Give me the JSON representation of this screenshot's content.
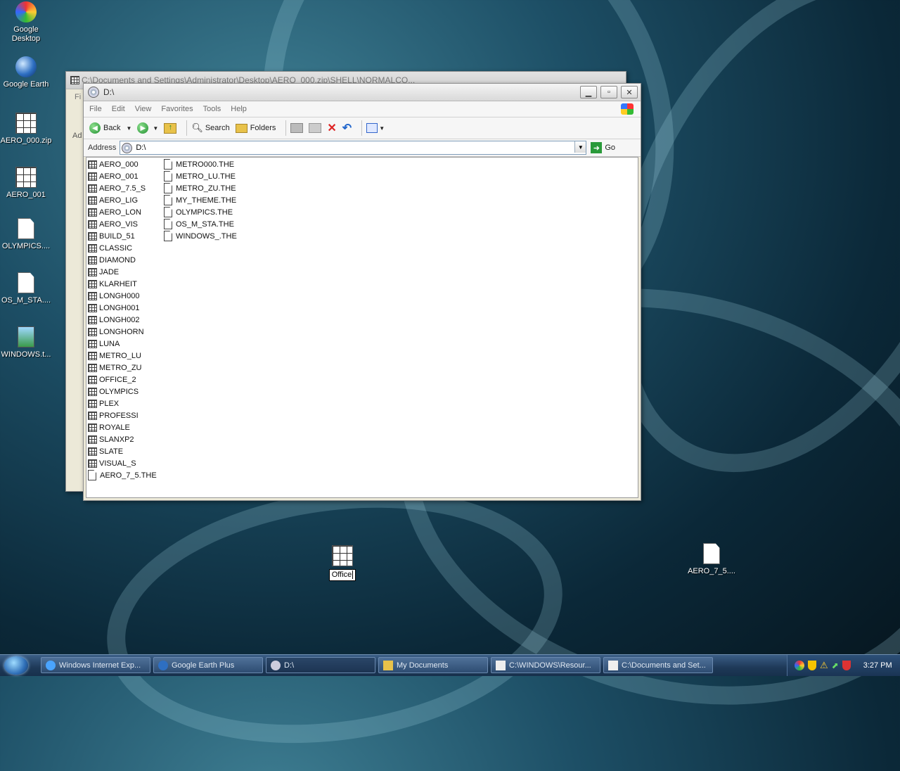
{
  "desktop": {
    "icons": [
      {
        "label_line1": "Google",
        "label_line2": "Desktop",
        "icon": "google-desktop-icon"
      },
      {
        "label": "Google Earth",
        "icon": "google-earth-icon"
      },
      {
        "label": "AERO_000.zip",
        "icon": "theme-file-icon"
      },
      {
        "label": "AERO_001",
        "icon": "theme-file-icon"
      },
      {
        "label": "OLYMPICS....",
        "icon": "document-icon"
      },
      {
        "label": "OS_M_STA....",
        "icon": "document-icon"
      },
      {
        "label": "WINDOWS.t...",
        "icon": "image-file-icon"
      }
    ],
    "renaming_icon_value": "Office",
    "aero_icon_label": "AERO_7_5...."
  },
  "back_window": {
    "title": "C:\\Documents and Settings\\Administrator\\Desktop\\AERO_000.zip\\SHELL\\NORMALCO...",
    "menu_fragment": "Fi",
    "address_fragment": "Ad"
  },
  "explorer": {
    "title": "D:\\",
    "menu": [
      "File",
      "Edit",
      "View",
      "Favorites",
      "Tools",
      "Help"
    ],
    "toolbar": {
      "back": "Back",
      "search": "Search",
      "folders": "Folders"
    },
    "address_label": "Address",
    "address_value": "D:\\",
    "go_label": "Go",
    "files_col1": [
      "AERO_000",
      "AERO_001",
      "AERO_7.5_S",
      "AERO_LIG",
      "AERO_LON",
      "AERO_VIS",
      "BUILD_51",
      "CLASSIC",
      "DIAMOND",
      "JADE",
      "KLARHEIT",
      "LONGH000",
      "LONGH001",
      "LONGH002",
      "LONGHORN",
      "LUNA",
      "METRO_LU",
      "METRO_ZU",
      "OFFICE_2",
      "OLYMPICS",
      "PLEX",
      "PROFESSI",
      "ROYALE",
      "SLANXP2",
      "SLATE",
      "VISUAL_S"
    ],
    "files_col1_doc": "AERO_7_5.THE",
    "files_col2": [
      "METRO000.THE",
      "METRO_LU.THE",
      "METRO_ZU.THE",
      "MY_THEME.THE",
      "OLYMPICS.THE",
      "OS_M_STA.THE",
      "WINDOWS_.THE"
    ]
  },
  "taskbar": {
    "tasks": [
      "Windows Internet Exp...",
      "Google Earth Plus",
      "D:\\",
      "My Documents",
      "C:\\WINDOWS\\Resour...",
      "C:\\Documents and Set..."
    ],
    "clock": "3:27 PM"
  },
  "colors": {
    "accent": "#1e3958",
    "window_bg": "#ece9d8"
  }
}
